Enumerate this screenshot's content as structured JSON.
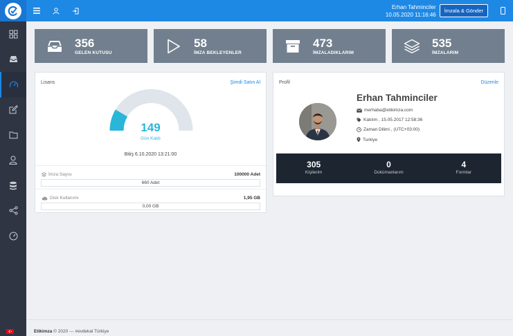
{
  "header": {
    "user_name": "Erhan Tahminciler",
    "datetime": "10.05.2020 11:16:46",
    "send_button": "İmzala & Gönder",
    "accent": "#1e88e5"
  },
  "stats": [
    {
      "value": "356",
      "label": "GELEN KUTUSU",
      "icon": "inbox-icon"
    },
    {
      "value": "58",
      "label": "İMZA BEKLEYENLER",
      "icon": "play-icon"
    },
    {
      "value": "473",
      "label": "İMZALADIKLARIM",
      "icon": "archive-icon"
    },
    {
      "value": "535",
      "label": "İMZALARIM",
      "icon": "layers-icon"
    }
  ],
  "license": {
    "title": "Lisans",
    "buy_link": "Şimdi Satın Al",
    "days_left": "149",
    "days_left_label": "Gün Kaldı",
    "end_date": "Bitiş  6.10.2020 13:21:00",
    "gauge_fraction": 0.17,
    "signature_label": "İmza Sayısı",
    "signature_total": "100000 Adet",
    "signature_used": "660 Adet",
    "disk_label": "Disk Kullanımı",
    "disk_total": "1,95 GB",
    "disk_used": "0,00 GB"
  },
  "profile": {
    "title": "Profil",
    "edit_link": "Düzenle",
    "name": "Erhan Tahminciler",
    "email": "merhaba@etikimza.com",
    "joined": "Katılım , 15.05.2017 12:58:36",
    "timezone": "Zaman Dilimi , (UTC+03:00)",
    "country": "Turkiye",
    "counts": [
      {
        "value": "305",
        "label": "Kişilerim"
      },
      {
        "value": "0",
        "label": "Dokümanlarım"
      },
      {
        "value": "4",
        "label": "Formlar"
      }
    ]
  },
  "footer": {
    "brand": "Etikimza",
    "text": " © 2020 --- #evdekal Türkiye"
  }
}
